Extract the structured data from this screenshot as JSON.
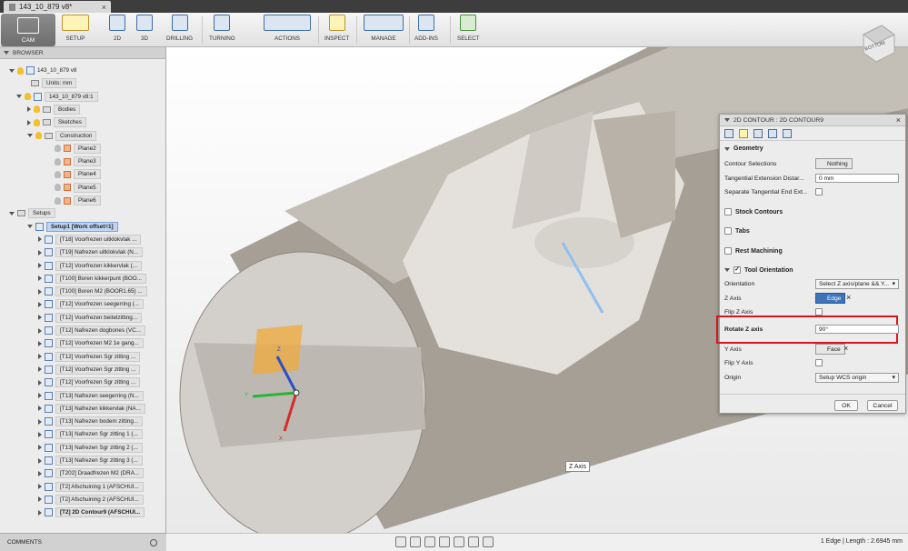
{
  "window": {
    "tab_title": "143_10_879 v8*"
  },
  "toolbar": {
    "cam": "CAM",
    "groups": [
      "SETUP",
      "2D",
      "3D",
      "DRILLING",
      "TURNING",
      "ACTIONS",
      "INSPECT",
      "MANAGE",
      "ADD-INS",
      "SELECT"
    ]
  },
  "browser": {
    "title": "BROWSER",
    "root": "143_10_879 v8",
    "units": "Units: mm",
    "component": "143_10_879 v8:1",
    "folders": [
      "Bodies",
      "Sketches",
      "Construction"
    ],
    "planes": [
      "Plane2",
      "Plane3",
      "Plane4",
      "Plane5",
      "Plane6"
    ],
    "setups": "Setups",
    "setup": "Setup1 [Work offset=1]",
    "operations": [
      "[T18] Voorfrezen uitklokvlak ...",
      "[T19] Nafrezen uitklokvlak (N...",
      "[T12] Voorfrezen kikkervlak (...",
      "[T100] Boren kikkerpunt (BOO...",
      "[T100] Boren M2 (BOOR1.65) ...",
      "[T12] Voorfrezen seegerring (...",
      "[T12] Voorfrezen beitelzitting...",
      "[T12] Nafrezen dogbones (VC...",
      "[T12] Voorfrezen M2 1e gang...",
      "[T12] Voorfrezen Sgr zitting ...",
      "[T12] Voorfrezen Sgr zitting ...",
      "[T12] Voorfrezen Sgr zitting ...",
      "[T13] Nafrezen seegerring (N...",
      "[T13] Nafrezen kikkervlak (NA...",
      "[T13] Nafrezen bodem zitting...",
      "[T13] Nafrezen Sgr zitting 1 (...",
      "[T13] Nafrezen Sgr zitting 2 (...",
      "[T13] Nafrezen Sgr zitting 3 (...",
      "[T202] Draadfrezen M2 (DRA...",
      "[T2] Afschuining 1 (AFSCHUI...",
      "[T2] Afschuining 2 (AFSCHUI...",
      "[T2] 2D Contour9 (AFSCHUI..."
    ]
  },
  "comments": "COMMENTS",
  "status": "1 Edge | Length : 2.6945 mm",
  "tooltip": "Z Axis",
  "viewcube": {
    "face": "BOTTOM"
  },
  "axes": {
    "x": "X",
    "y": "Y",
    "z": "Z"
  },
  "panel": {
    "title": "2D CONTOUR : 2D CONTOUR9",
    "geometry": {
      "heading": "Geometry",
      "contour_selections_label": "Contour Selections",
      "contour_selections_value": "Nothing",
      "tangential_ext_label": "Tangential Extension Distar...",
      "tangential_ext_value": "0 mm",
      "separate_tangential_label": "Separate Tangential End Ext..."
    },
    "stock_contours": "Stock Contours",
    "tabs": "Tabs",
    "rest_machining": "Rest Machining",
    "tool_orientation": {
      "heading": "Tool Orientation",
      "orientation_label": "Orientation",
      "orientation_value": "Select Z axis/plane && Y...",
      "z_axis_label": "Z Axis",
      "z_axis_value": "Edge",
      "flip_z_label": "Flip Z Axis",
      "rotate_z_label": "Rotate Z axis",
      "rotate_z_value": "90°",
      "y_axis_label": "Y Axis",
      "y_axis_value": "Face",
      "flip_y_label": "Flip Y Axis",
      "origin_label": "Origin",
      "origin_value": "Setup WCS origin"
    },
    "ok": "OK",
    "cancel": "Cancel"
  }
}
